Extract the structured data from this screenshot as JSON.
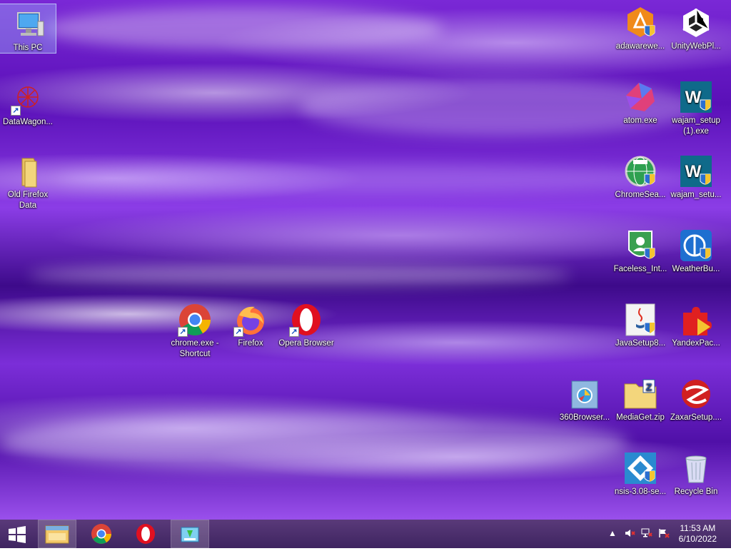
{
  "desktop": {
    "icons": [
      {
        "label": "This PC"
      },
      {
        "label": "DataWagon..."
      },
      {
        "label": "Old Firefox Data"
      },
      {
        "label": "chrome.exe - Shortcut"
      },
      {
        "label": "Firefox"
      },
      {
        "label": "Opera Browser"
      },
      {
        "label": "adawarewe..."
      },
      {
        "label": "UnityWebPl..."
      },
      {
        "label": "atom.exe"
      },
      {
        "label": "wajam_setup (1).exe"
      },
      {
        "label": "ChromeSea..."
      },
      {
        "label": "wajam_setu..."
      },
      {
        "label": "Faceless_Int..."
      },
      {
        "label": "WeatherBu..."
      },
      {
        "label": "JavaSetup8..."
      },
      {
        "label": "YandexPac..."
      },
      {
        "label": "360Browser..."
      },
      {
        "label": "MediaGet.zip"
      },
      {
        "label": "ZaxarSetup...."
      },
      {
        "label": "nsis-3.08-se..."
      },
      {
        "label": "Recycle Bin"
      }
    ]
  },
  "taskbar": {
    "start_icon": "windows-logo",
    "pinned": [
      "file-explorer",
      "chrome",
      "opera",
      "installer-window"
    ],
    "clock_time": "11:53 AM",
    "clock_date": "6/10/2022"
  },
  "colors": {
    "taskbar_bg": "#4a2e6a",
    "wallpaper_primary": "#7a28d6"
  }
}
